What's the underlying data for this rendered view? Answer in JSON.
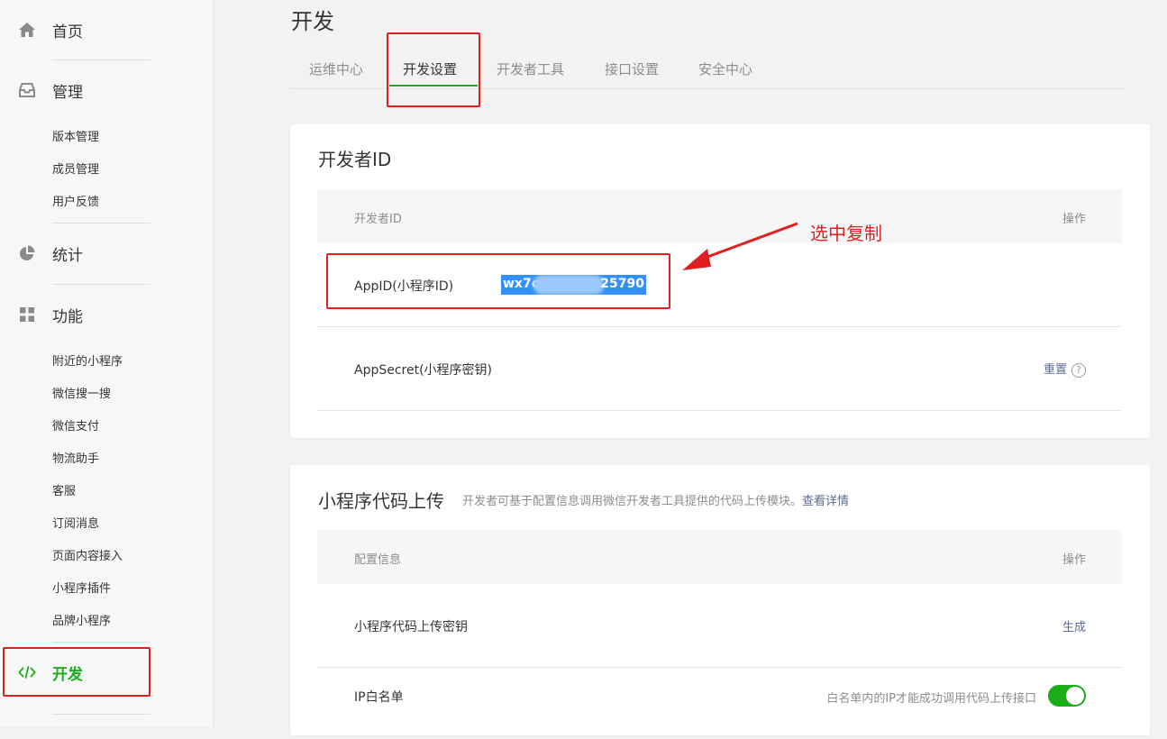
{
  "sidebar": {
    "home": "首页",
    "manage": "管理",
    "manage_items": [
      "版本管理",
      "成员管理",
      "用户反馈"
    ],
    "stats": "统计",
    "features": "功能",
    "feature_items": [
      "附近的小程序",
      "微信搜一搜",
      "微信支付",
      "物流助手",
      "客服",
      "订阅消息",
      "页面内容接入",
      "小程序插件",
      "品牌小程序"
    ],
    "dev": "开发"
  },
  "page": {
    "title": "开发",
    "tabs": [
      "运维中心",
      "开发设置",
      "开发者工具",
      "接口设置",
      "安全中心"
    ],
    "active_tab": "开发设置"
  },
  "dev_id_card": {
    "title": "开发者ID",
    "col_name": "开发者ID",
    "col_op": "操作",
    "appid_label": "AppID(小程序ID)",
    "appid_prefix": "wx7c",
    "appid_suffix": "25790",
    "secret_label": "AppSecret(小程序密钥)",
    "reset_label": "重置",
    "help_glyph": "?"
  },
  "annotation": {
    "text": "选中复制"
  },
  "upload_card": {
    "title": "小程序代码上传",
    "desc": "开发者可基于配置信息调用微信开发者工具提供的代码上传模块。",
    "desc_link": "查看详情",
    "col_name": "配置信息",
    "col_op": "操作",
    "key_label": "小程序代码上传密钥",
    "generate_label": "生成",
    "ip_label": "IP白名单",
    "ip_desc": "白名单内的IP才能成功调用代码上传接口",
    "ip_toggle_on": true
  },
  "colors": {
    "accent_green": "#1aad19",
    "link_blue": "#576b95",
    "annotation_red": "#e02020",
    "selection_blue": "#3390ff"
  }
}
